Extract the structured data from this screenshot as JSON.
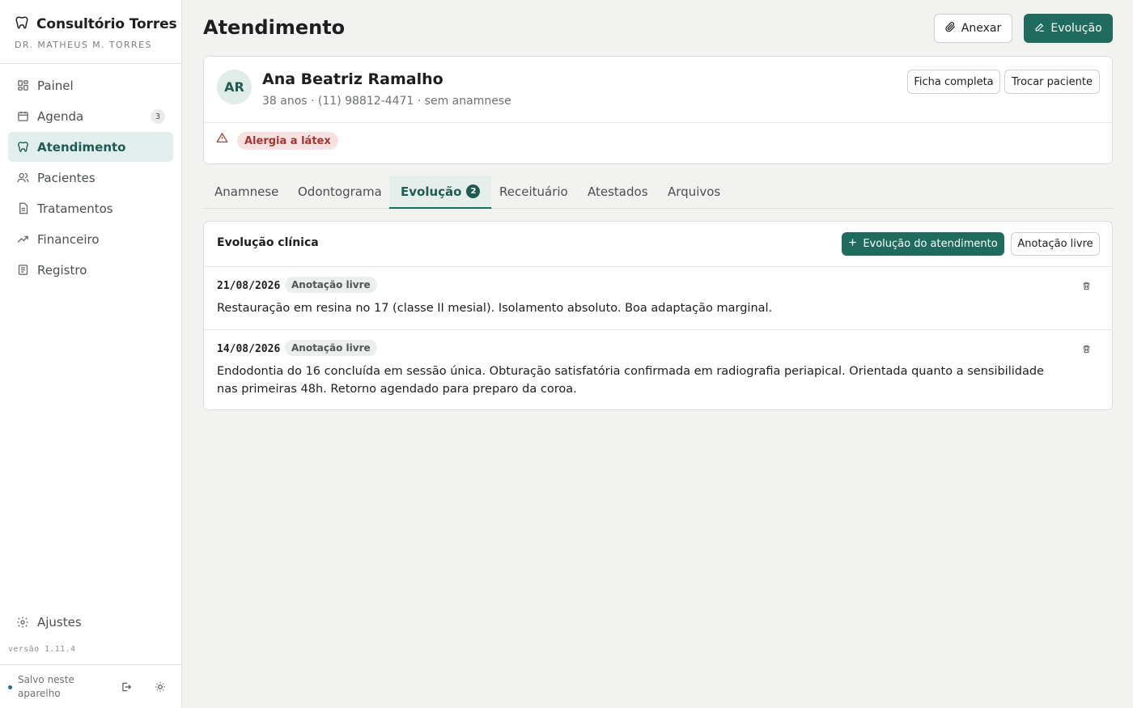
{
  "brand": {
    "name": "Consultório Torres",
    "subtitle": "DR. MATHEUS M. TORRES"
  },
  "sidebar": {
    "items": [
      {
        "label": "Painel",
        "icon": "dashboard-icon"
      },
      {
        "label": "Agenda",
        "icon": "calendar-icon",
        "badge": "3"
      },
      {
        "label": "Atendimento",
        "icon": "tooth-icon",
        "active": true
      },
      {
        "label": "Pacientes",
        "icon": "users-icon"
      },
      {
        "label": "Tratamentos",
        "icon": "document-icon"
      },
      {
        "label": "Financeiro",
        "icon": "trending-up-icon"
      },
      {
        "label": "Registro",
        "icon": "list-icon"
      }
    ],
    "settings_label": "Ajustes",
    "version": "versão 1.11.4",
    "saved_text": "Salvo neste aparelho"
  },
  "header": {
    "title": "Atendimento",
    "attach_label": "Anexar",
    "evolution_label": "Evolução"
  },
  "patient": {
    "initials": "AR",
    "name": "Ana Beatriz Ramalho",
    "meta": "38 anos · (11) 98812-4471 · sem anamnese",
    "full_record_label": "Ficha completa",
    "switch_label": "Trocar paciente",
    "allergy": "Alergia a látex"
  },
  "tabs": [
    {
      "label": "Anamnese"
    },
    {
      "label": "Odontograma"
    },
    {
      "label": "Evolução",
      "badge": "2",
      "active": true
    },
    {
      "label": "Receituário"
    },
    {
      "label": "Atestados"
    },
    {
      "label": "Arquivos"
    }
  ],
  "evolution": {
    "title": "Evolução clínica",
    "new_label": "Evolução do atendimento",
    "free_label": "Anotação livre",
    "entries": [
      {
        "date": "21/08/2026",
        "tag": "Anotação livre",
        "text": "Restauração em resina no 17 (classe II mesial). Isolamento absoluto. Boa adaptação marginal."
      },
      {
        "date": "14/08/2026",
        "tag": "Anotação livre",
        "text": "Endodontia do 16 concluída em sessão única. Obturação satisfatória confirmada em radiografia periapical. Orientada quanto a sensibilidade nas primeiras 48h. Retorno agendado para preparo da coroa."
      }
    ]
  },
  "colors": {
    "accent": "#1f6b5e",
    "active_bg": "#e1eeeb",
    "danger": "#a63631"
  }
}
